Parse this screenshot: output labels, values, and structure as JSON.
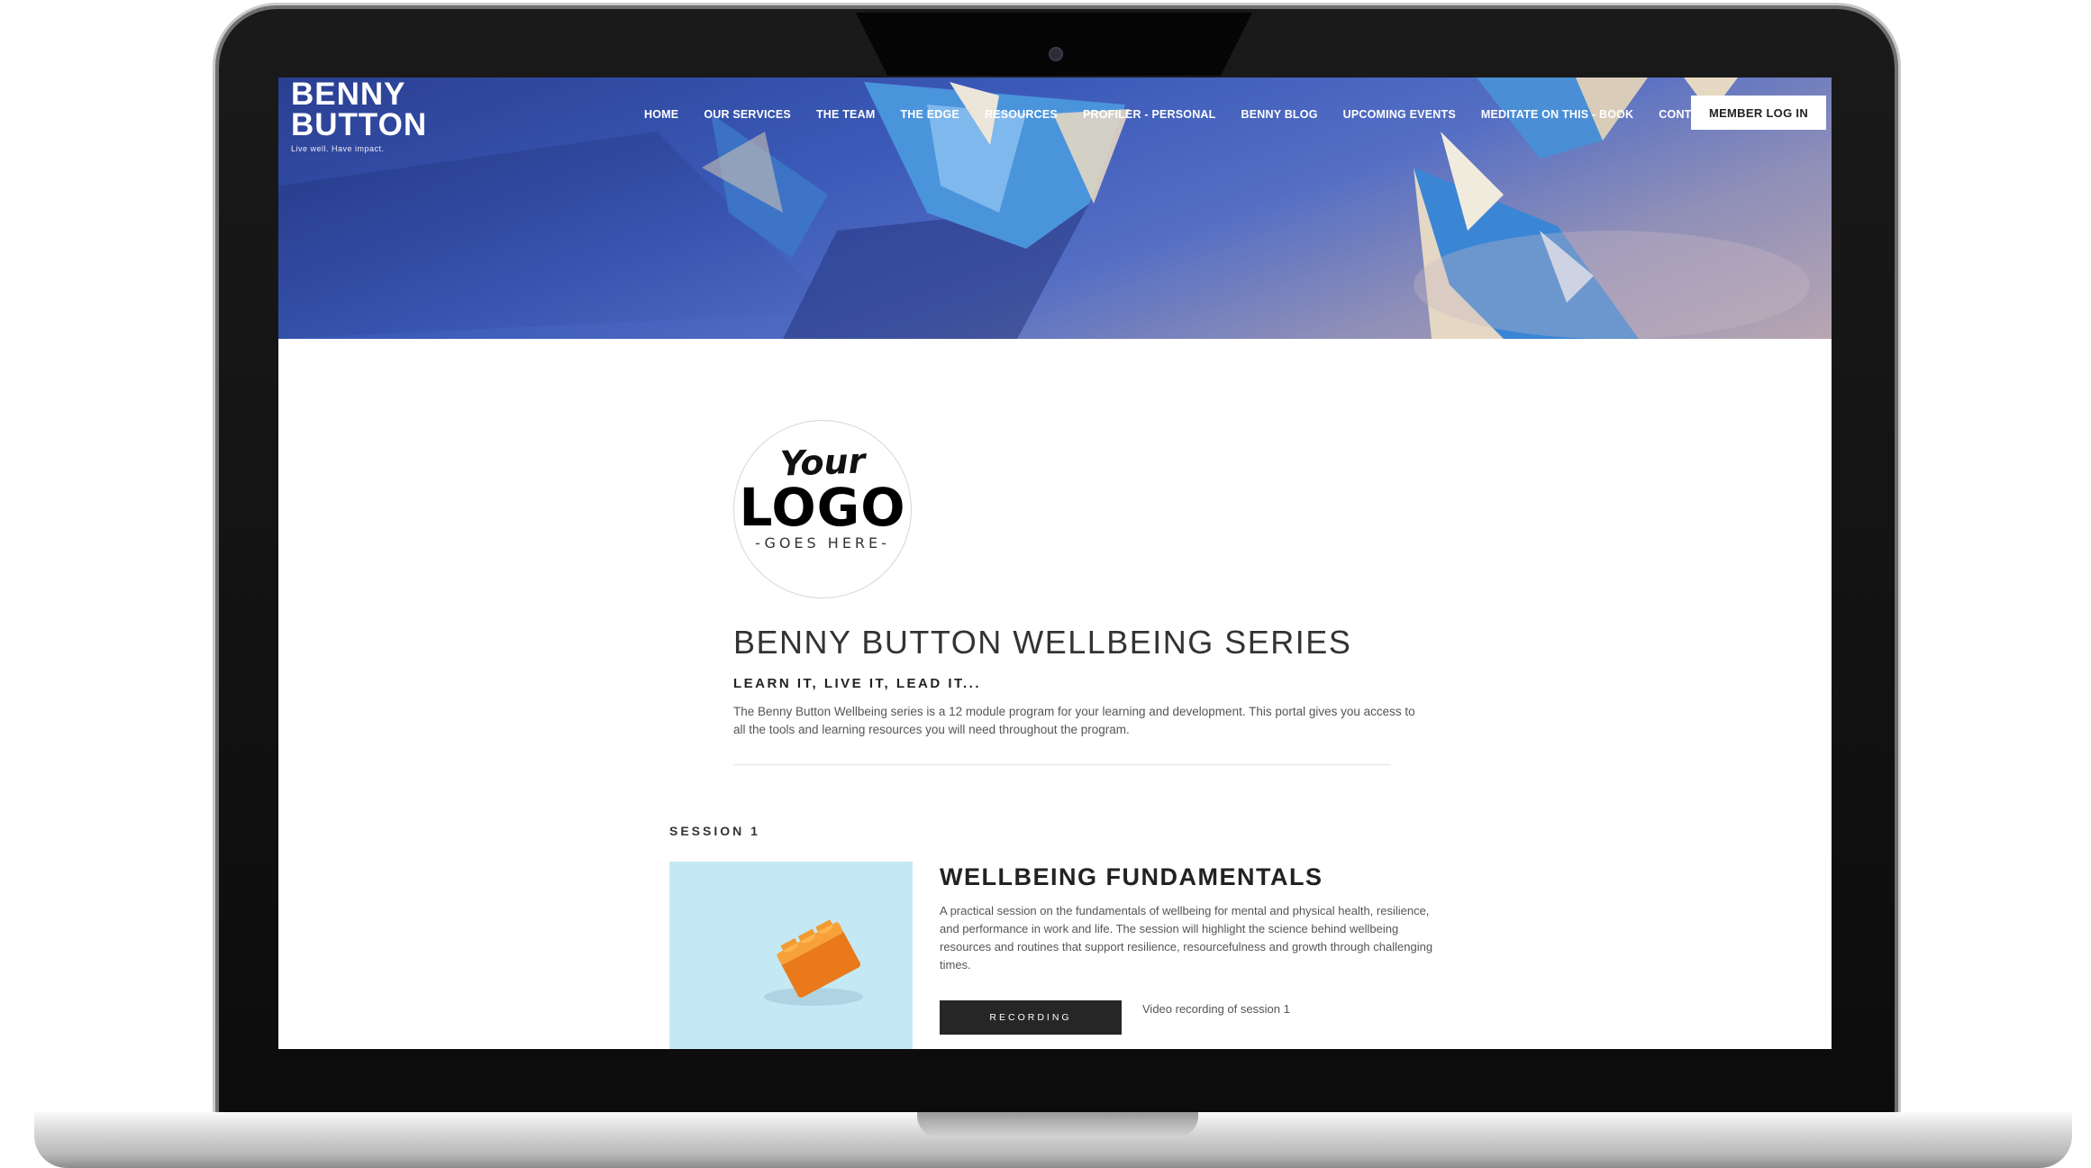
{
  "brand": {
    "line1": "BENNY",
    "line2": "BUTTON",
    "tagline": "Live well. Have impact."
  },
  "nav": {
    "items": [
      "HOME",
      "OUR SERVICES",
      "THE TEAM",
      "THE EDGE",
      "RESOURCES",
      "PROFILER - PERSONAL",
      "BENNY BLOG",
      "UPCOMING EVENTS",
      "MEDITATE ON THIS - BOOK",
      "CONTACT"
    ],
    "member_login": "MEMBER LOG IN"
  },
  "logo": {
    "your": "Your",
    "main": "LOGO",
    "sub": "-GOES HERE-"
  },
  "series": {
    "title": "BENNY BUTTON WELLBEING SERIES",
    "tagline": "LEARN IT, LIVE IT, LEAD IT...",
    "description": "The Benny Button Wellbeing series is a 12 module program for your learning and development. This portal gives you access to all the tools and learning resources you will need throughout the program."
  },
  "session": {
    "label": "SESSION 1",
    "title": "WELLBEING FUNDAMENTALS",
    "description": "A practical session on the fundamentals of wellbeing for mental and physical health, resilience, and performance in work and life. The session will highlight the science behind wellbeing resources and routines that support resilience, resourcefulness and growth through challenging times.",
    "button_label": "RECORDING",
    "button_note": "Video recording of session 1"
  },
  "colors": {
    "hero_blue": "#3b5ab8",
    "button_dark": "#262626",
    "thumb_bg": "#c5e8f5",
    "brick_orange": "#f08a1e"
  }
}
